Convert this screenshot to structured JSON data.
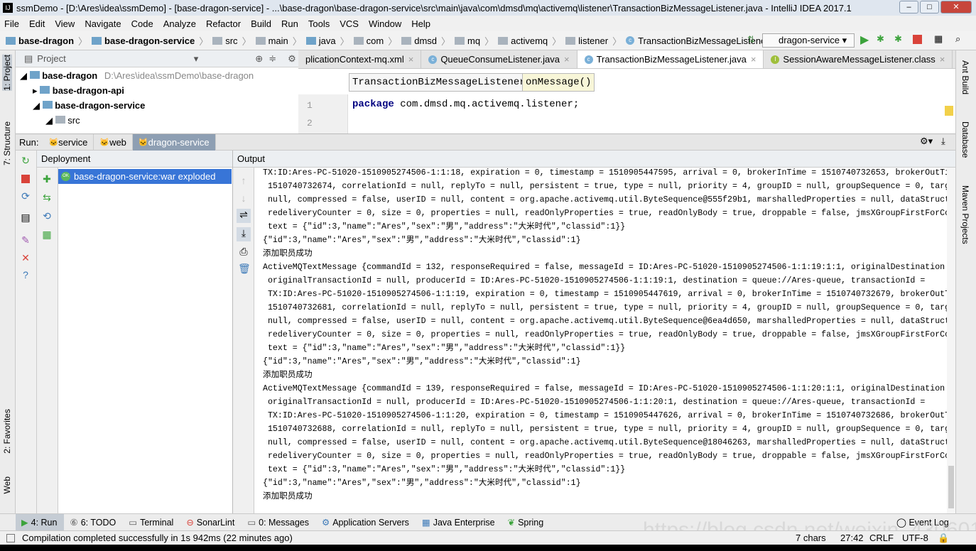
{
  "window": {
    "title": "ssmDemo - [D:\\Ares\\idea\\ssmDemo] - [base-dragon-service] - ...\\base-dragon\\base-dragon-service\\src\\main\\java\\com\\dmsd\\mq\\activemq\\listener\\TransactionBizMessageListener.java - IntelliJ IDEA 2017.1"
  },
  "menu": [
    "File",
    "Edit",
    "View",
    "Navigate",
    "Code",
    "Analyze",
    "Refactor",
    "Build",
    "Run",
    "Tools",
    "VCS",
    "Window",
    "Help"
  ],
  "breadcrumbs": [
    "base-dragon",
    "base-dragon-service",
    "src",
    "main",
    "java",
    "com",
    "dmsd",
    "mq",
    "activemq",
    "listener",
    "TransactionBizMessageListener"
  ],
  "run_config": "dragon-service",
  "left_tabs": [
    "1: Project",
    "7: Structure",
    "2: Favorites",
    "Web"
  ],
  "right_tabs": [
    "Ant Build",
    "Database",
    "Maven Projects"
  ],
  "project": {
    "title": "Project",
    "tree": [
      {
        "label": "base-dragon",
        "path": "D:\\Ares\\idea\\ssmDemo\\base-dragon"
      },
      {
        "label": "base-dragon-api"
      },
      {
        "label": "base-dragon-service"
      },
      {
        "label": "src"
      }
    ]
  },
  "editor": {
    "tabs": [
      "plicationContext-mq.xml",
      "QueueConsumeListener.java",
      "TransactionBizMessageListener.java",
      "SessionAwareMessageListener.class"
    ],
    "active_tab": 2,
    "crumbs": [
      "TransactionBizMessageListener",
      "onMessage()"
    ],
    "lines": [
      {
        "n": "1",
        "keyword": "package",
        "text": " com.dmsd.mq.activemq.listener;"
      },
      {
        "n": "2",
        "keyword": "",
        "text": ""
      }
    ]
  },
  "run": {
    "label": "Run:",
    "tabs": [
      "service",
      "web",
      "dragon-service"
    ],
    "active": 2
  },
  "deployment": {
    "title": "Deployment",
    "item": "base-dragon-service:war exploded",
    "badge": "OK"
  },
  "output": {
    "title": "Output",
    "lines": [
      "TX:ID:Ares-PC-51020-1510905274506-1:1:18, expiration = 0, timestamp = 1510905447595, arrival = 0, brokerInTime = 1510740732653, brokerOutTime =",
      " 1510740732674, correlationId = null, replyTo = null, persistent = true, type = null, priority = 4, groupID = null, groupSequence = 0, targetConsumerId =",
      " null, compressed = false, userID = null, content = org.apache.activemq.util.ByteSequence@555f29b1, marshalledProperties = null, dataStructure = null,",
      " redeliveryCounter = 0, size = 0, properties = null, readOnlyProperties = true, readOnlyBody = true, droppable = false, jmsXGroupFirstForConsumer = false,",
      " text = {\"id\":3,\"name\":\"Ares\",\"sex\":\"男\",\"address\":\"大米时代\",\"classid\":1}}",
      "{\"id\":3,\"name\":\"Ares\",\"sex\":\"男\",\"address\":\"大米时代\",\"classid\":1}",
      "添加职员成功",
      "ActiveMQTextMessage {commandId = 132, responseRequired = false, messageId = ID:Ares-PC-51020-1510905274506-1:1:19:1:1, originalDestination = null,",
      " originalTransactionId = null, producerId = ID:Ares-PC-51020-1510905274506-1:1:19:1, destination = queue://Ares-queue, transactionId =",
      " TX:ID:Ares-PC-51020-1510905274506-1:1:19, expiration = 0, timestamp = 1510905447619, arrival = 0, brokerInTime = 1510740732679, brokerOutTime =",
      " 1510740732681, correlationId = null, replyTo = null, persistent = true, type = null, priority = 4, groupID = null, groupSequence = 0, targetConsumerId =",
      " null, compressed = false, userID = null, content = org.apache.activemq.util.ByteSequence@6ea4d650, marshalledProperties = null, dataStructure = null,",
      " redeliveryCounter = 0, size = 0, properties = null, readOnlyProperties = true, readOnlyBody = true, droppable = false, jmsXGroupFirstForConsumer = false,",
      " text = {\"id\":3,\"name\":\"Ares\",\"sex\":\"男\",\"address\":\"大米时代\",\"classid\":1}}",
      "{\"id\":3,\"name\":\"Ares\",\"sex\":\"男\",\"address\":\"大米时代\",\"classid\":1}",
      "添加职员成功",
      "ActiveMQTextMessage {commandId = 139, responseRequired = false, messageId = ID:Ares-PC-51020-1510905274506-1:1:20:1:1, originalDestination = null,",
      " originalTransactionId = null, producerId = ID:Ares-PC-51020-1510905274506-1:1:20:1, destination = queue://Ares-queue, transactionId =",
      " TX:ID:Ares-PC-51020-1510905274506-1:1:20, expiration = 0, timestamp = 1510905447626, arrival = 0, brokerInTime = 1510740732686, brokerOutTime =",
      " 1510740732688, correlationId = null, replyTo = null, persistent = true, type = null, priority = 4, groupID = null, groupSequence = 0, targetConsumerId =",
      " null, compressed = false, userID = null, content = org.apache.activemq.util.ByteSequence@18046263, marshalledProperties = null, dataStructure = null,",
      " redeliveryCounter = 0, size = 0, properties = null, readOnlyProperties = true, readOnlyBody = true, droppable = false, jmsXGroupFirstForConsumer = false,",
      " text = {\"id\":3,\"name\":\"Ares\",\"sex\":\"男\",\"address\":\"大米时代\",\"classid\":1}}",
      "{\"id\":3,\"name\":\"Ares\",\"sex\":\"男\",\"address\":\"大米时代\",\"classid\":1}",
      "添加职员成功"
    ]
  },
  "bottom_tabs": [
    "4: Run",
    "6: TODO",
    "Terminal",
    "SonarLint",
    "0: Messages",
    "Application Servers",
    "Java Enterprise",
    "Spring"
  ],
  "event_log": "Event Log",
  "status": {
    "message": "Compilation completed successfully in 1s 942ms (22 minutes ago)",
    "chars": "7 chars",
    "position": "27:42",
    "line_sep": "CRLF",
    "encoding": "UTF-8"
  },
  "watermark": "https://blog.csdn.net/weixin_43060102",
  "colors": {
    "selection": "#3875d7",
    "keyword": "#000080",
    "run_green": "#3ca33c",
    "stop_red": "#d9433a"
  }
}
